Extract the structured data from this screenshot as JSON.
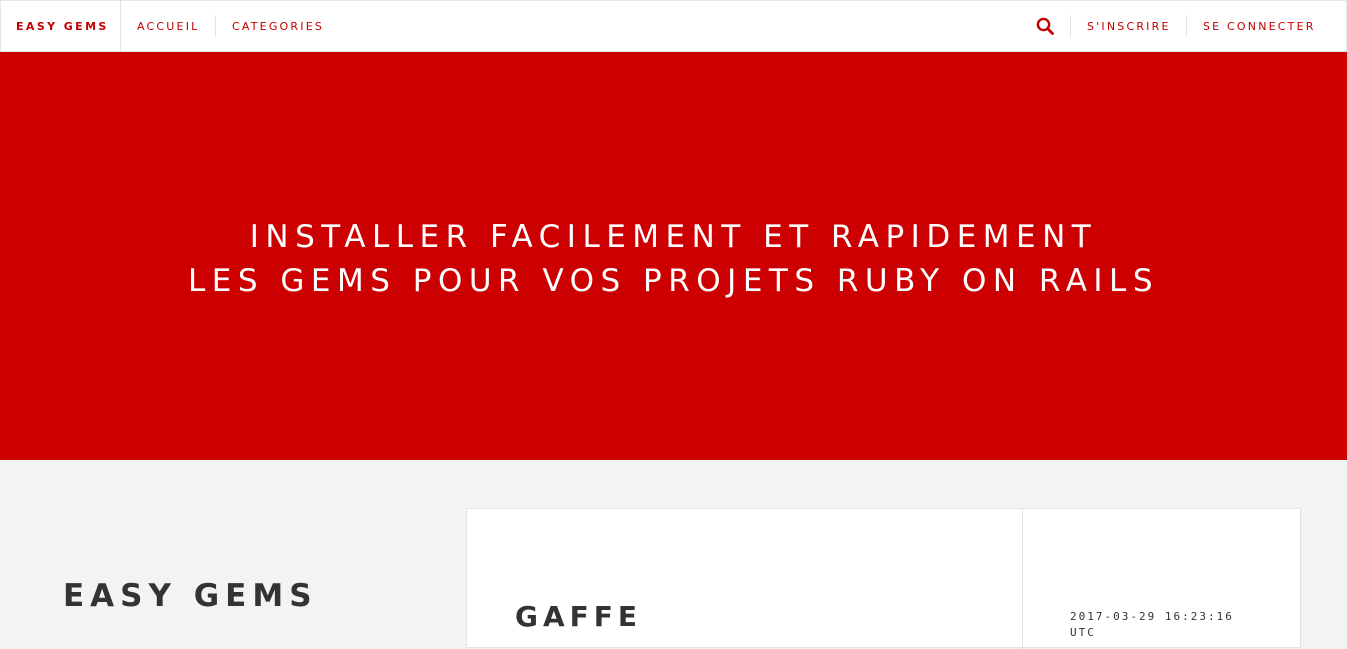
{
  "nav": {
    "brand": "EASY GEMS",
    "links": [
      "ACCUEIL",
      "CATEGORIES"
    ],
    "search_icon": "search-icon",
    "signup": "S'INSCRIRE",
    "login": "SE CONNECTER"
  },
  "hero": {
    "line1": "INSTALLER FACILEMENT ET RAPIDEMENT",
    "line2": "LES GEMS POUR VOS PROJETS RUBY ON RAILS"
  },
  "main": {
    "site_title": "EASY GEMS",
    "post": {
      "title": "GAFFE",
      "date": "2017-03-29 16:23:16 UTC"
    }
  },
  "colors": {
    "accent": "#cc0000",
    "nav_text": "#c20000",
    "background": "#f3f3f3",
    "heading_text": "#333333"
  }
}
